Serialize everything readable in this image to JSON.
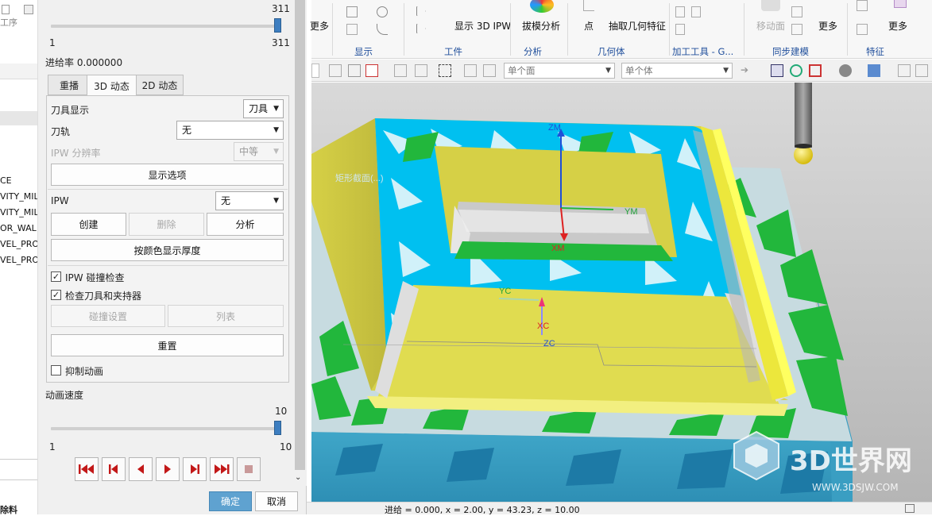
{
  "left_strip": {
    "top_label": "工序",
    "rows": [
      "CE",
      "VITY_MIL",
      "VITY_MIL",
      "OR_WAL",
      "VEL_PRO",
      "VEL_PRO"
    ],
    "bottom_label": "除料"
  },
  "dialog": {
    "frame_slider": {
      "value": "311",
      "min": "1",
      "max": "311",
      "fraction": 1.0
    },
    "feed_rate": "进给率 0.000000",
    "tabs": [
      "重播",
      "3D 动态",
      "2D 动态"
    ],
    "active_tab": 1,
    "tool_display": {
      "label": "刀具显示",
      "value": "刀具"
    },
    "toolpath": {
      "label": "刀轨",
      "value": "无"
    },
    "ipw_resolution": {
      "label": "IPW 分辨率",
      "value": "中等"
    },
    "display_options": "显示选项",
    "ipw": {
      "label": "IPW",
      "value": "无"
    },
    "create": "创建",
    "delete": "删除",
    "analyze": "分析",
    "color_thickness": "按颜色显示厚度",
    "ipw_collision": {
      "label": "IPW 碰撞检查",
      "checked": true
    },
    "check_holder": {
      "label": "检查刀具和夹持器",
      "checked": true
    },
    "collision_settings": "碰撞设置",
    "list": "列表",
    "reset": "重置",
    "suppress": {
      "label": "抑制动画",
      "checked": false
    },
    "speed": {
      "label": "动画速度",
      "value": "10",
      "min": "1",
      "max": "10",
      "fraction": 1.0
    },
    "ok": "确定",
    "cancel": "取消"
  },
  "ribbon": {
    "more1": "更多",
    "show": "显示",
    "part_group": "工件",
    "show_ipw": "显示 3D IPW",
    "draft": "拔模分析",
    "analysis": "分析",
    "point": "点",
    "extract": "抽取几何特征",
    "geometry": "几何体",
    "mfg": "加工工具 - G...",
    "move_face": "移动面",
    "more2": "更多",
    "sync": "同步建模",
    "more3": "更多",
    "feature": "特征"
  },
  "toolbar": {
    "filter1": "单个面",
    "filter2": "单个体"
  },
  "viewport": {
    "axis_labels": [
      "ZM",
      "YM",
      "XM",
      "YC",
      "XC",
      "ZC"
    ],
    "faded_label": "矩形截面(...)",
    "watermark_main": "3D世界网",
    "watermark_sub": "WWW.3DSJW.COM",
    "colors": {
      "part": "#d8d44a",
      "ipw": "#00c0f0",
      "gouge": "#22b73c",
      "stock": "#c7dbe0"
    }
  },
  "status": "进给 = 0.000, x = 2.00, y = 43.23, z = 10.00"
}
